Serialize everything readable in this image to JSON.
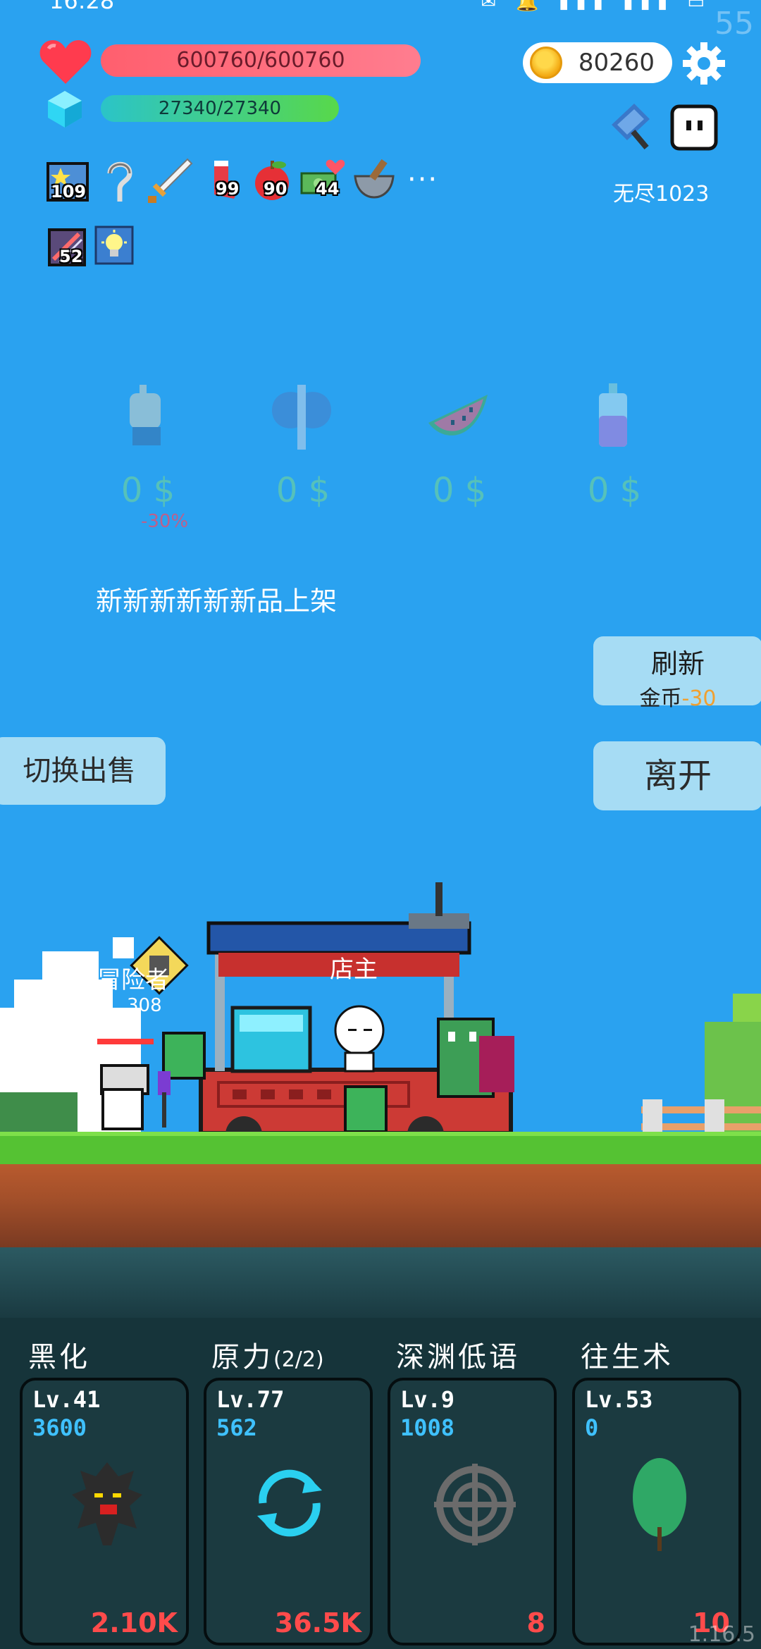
{
  "status_bar": {
    "time": "16:28",
    "fps": "55"
  },
  "player": {
    "hp_text": "600760/600760",
    "mp_text": "27340/27340",
    "coins": "80260",
    "endless_label": "无尽1023"
  },
  "items": [
    {
      "icon": "star-card-icon",
      "count": "109"
    },
    {
      "icon": "hook-icon",
      "count": ""
    },
    {
      "icon": "sword-icon",
      "count": ""
    },
    {
      "icon": "sock-icon",
      "count": "99"
    },
    {
      "icon": "apple-icon",
      "count": "90"
    },
    {
      "icon": "cash-heart-icon",
      "count": "44"
    },
    {
      "icon": "mortar-icon",
      "count": ""
    }
  ],
  "items_row2": [
    {
      "icon": "scroll-icon",
      "count": "52"
    },
    {
      "icon": "lightbulb-icon",
      "count": ""
    }
  ],
  "more_label": "···",
  "shop": {
    "goods": [
      {
        "icon": "gauntlet-icon",
        "price": "0 $"
      },
      {
        "icon": "battle-axe-icon",
        "price": "0 $"
      },
      {
        "icon": "watermelon-icon",
        "price": "0 $"
      },
      {
        "icon": "potion-bottle-icon",
        "price": "0 $"
      }
    ],
    "discount": "-30%",
    "new_label": "新新新新新新品上架",
    "refresh_title": "刷新",
    "refresh_cost_label": "金币",
    "refresh_cost_value": "-30",
    "leave_label": "离开",
    "switch_label": "切换出售"
  },
  "scene": {
    "adventurer_label": "冒险者",
    "adventurer_num": "308",
    "shopkeeper_label": "店主"
  },
  "skills": [
    {
      "name": "黑化",
      "name_suffix": "",
      "lv": "Lv.41",
      "value": "3600",
      "cost": "2.10K",
      "icon": "dark-tree-icon"
    },
    {
      "name": "原力",
      "name_suffix": "(2/2)",
      "lv": "Lv.77",
      "value": "562",
      "cost": "36.5K",
      "icon": "cycle-arrows-icon"
    },
    {
      "name": "深渊低语",
      "name_suffix": "",
      "lv": "Lv.9",
      "value": "1008",
      "cost": "8",
      "icon": "crosshair-icon"
    },
    {
      "name": "往生术",
      "name_suffix": "",
      "lv": "Lv.53",
      "value": "0",
      "cost": "10",
      "icon": "leaf-icon"
    }
  ],
  "version": "1.16.5"
}
